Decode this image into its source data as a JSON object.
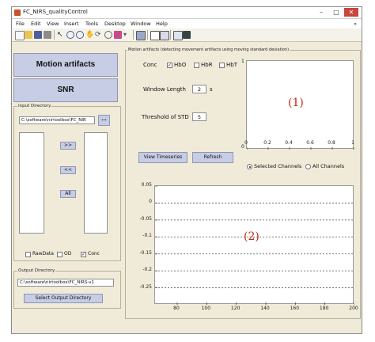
{
  "window": {
    "title": "FC_NIRS_qualityControl",
    "controls": {
      "minimize": "–",
      "maximize": "□",
      "close": "✕"
    }
  },
  "menubar": {
    "items": [
      "File",
      "Edit",
      "View",
      "Insert",
      "Tools",
      "Desktop",
      "Window",
      "Help"
    ],
    "overflow": "»"
  },
  "toolbar": {
    "icons": [
      "new-file-icon",
      "open-file-icon",
      "save-icon",
      "print-icon",
      "pointer-icon",
      "zoom-in-icon",
      "zoom-out-icon",
      "pan-icon",
      "rotate-icon",
      "data-cursor-icon",
      "brush-icon",
      "link-icon",
      "colorbar-icon",
      "legend-icon",
      "hide-plot-tools-icon",
      "show-plot-tools-icon"
    ]
  },
  "left": {
    "motion_button": "Motion artifacts",
    "snr_button": "SNR",
    "input_dir": {
      "label": "Input Directory",
      "path": "C:\\software\\nirtoolbox\\FC_NIR",
      "browse": "...",
      "move_right": ">>",
      "move_left": "<<",
      "all": "All"
    },
    "checks": [
      {
        "label": "RawData",
        "checked": false
      },
      {
        "label": "OD",
        "checked": false
      },
      {
        "label": "Conc",
        "checked": true
      }
    ],
    "output_dir": {
      "label": "Output Directory",
      "path": "C:\\software\\nirtoolbox\\FC_NIRS-v1",
      "select_button": "Select Output Directory"
    }
  },
  "right": {
    "panel_title": "Motion artifacts (detecting movement artifacts using moving standard deviation)",
    "conc_label": "Conc",
    "conc_options": [
      {
        "label": "HbO",
        "checked": true
      },
      {
        "label": "HbR",
        "checked": false
      },
      {
        "label": "HbT",
        "checked": false
      }
    ],
    "window_length_label": "Window Length",
    "window_length_value": "2",
    "window_length_unit": "s",
    "threshold_label": "Threshold of STD",
    "threshold_value": "5",
    "view_button": "View Timeseries",
    "refresh_button": "Refresh",
    "radio": [
      {
        "label": "Selected Channels",
        "selected": true
      },
      {
        "label": "All Channels",
        "selected": false
      }
    ]
  },
  "chart_data": [
    {
      "type": "line",
      "annotation": "(1)",
      "xlim": [
        0,
        1
      ],
      "ylim": [
        0,
        1
      ],
      "xticks": [
        "0",
        "0.2",
        "0.4",
        "0.6",
        "0.8",
        "1"
      ],
      "yticks": [
        "0",
        "1"
      ],
      "series": []
    },
    {
      "type": "line",
      "annotation": "(2)",
      "xlim": [
        65,
        200
      ],
      "ylim": [
        -0.3,
        0.05
      ],
      "xticks": [
        "80",
        "100",
        "120",
        "140",
        "160",
        "180",
        "200"
      ],
      "yticks": [
        "0.05",
        "0",
        "-0.05",
        "-0.1",
        "-0.15",
        "-0.2",
        "-0.25"
      ],
      "grid": "dashed horizontal",
      "series": []
    }
  ]
}
